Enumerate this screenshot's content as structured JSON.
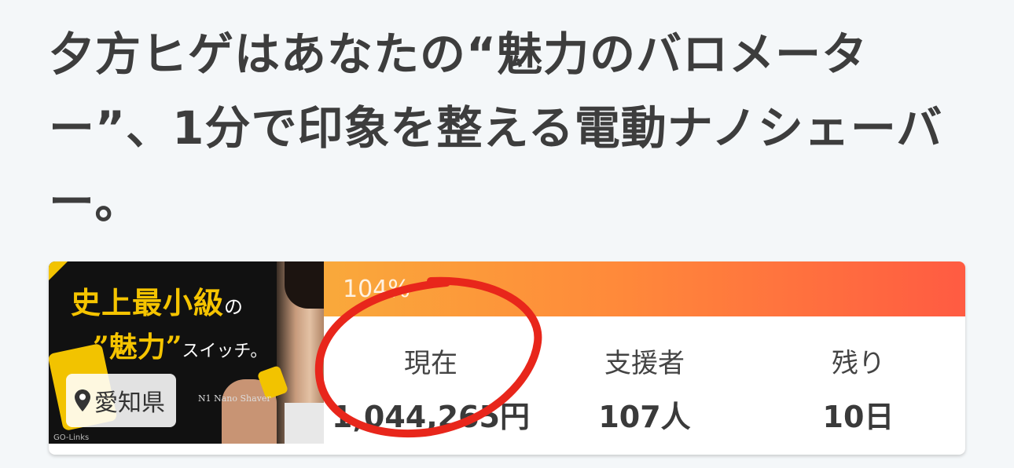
{
  "headline": "夕方ヒゲはあなたの“魅力のバロメーター”、1分で印象を整える電動ナノシェーバー。",
  "project_card": {
    "thumbnail": {
      "headline_part1": "史上最小級",
      "headline_part1_suffix": "の",
      "headline_part2": "”魅力”",
      "headline_part2_suffix": "スイッチ。",
      "product_tag": "N1 Nano Shaver",
      "brand_label": "GO-Links"
    },
    "location": "愛知県",
    "progress": {
      "label": "104%",
      "percent": 104
    },
    "stats": [
      {
        "label": "現在",
        "value": "1,044,265円"
      },
      {
        "label": "支援者",
        "value": "107人"
      },
      {
        "label": "残り",
        "value": "10日"
      }
    ]
  },
  "colors": {
    "background": "#f4f7f9",
    "bar_start": "#f9a93b",
    "bar_end": "#ff5b42",
    "annotation_red": "#e8261b",
    "thumbnail_accent": "#f5c400"
  },
  "icons": {
    "location": "map-pin-icon"
  }
}
